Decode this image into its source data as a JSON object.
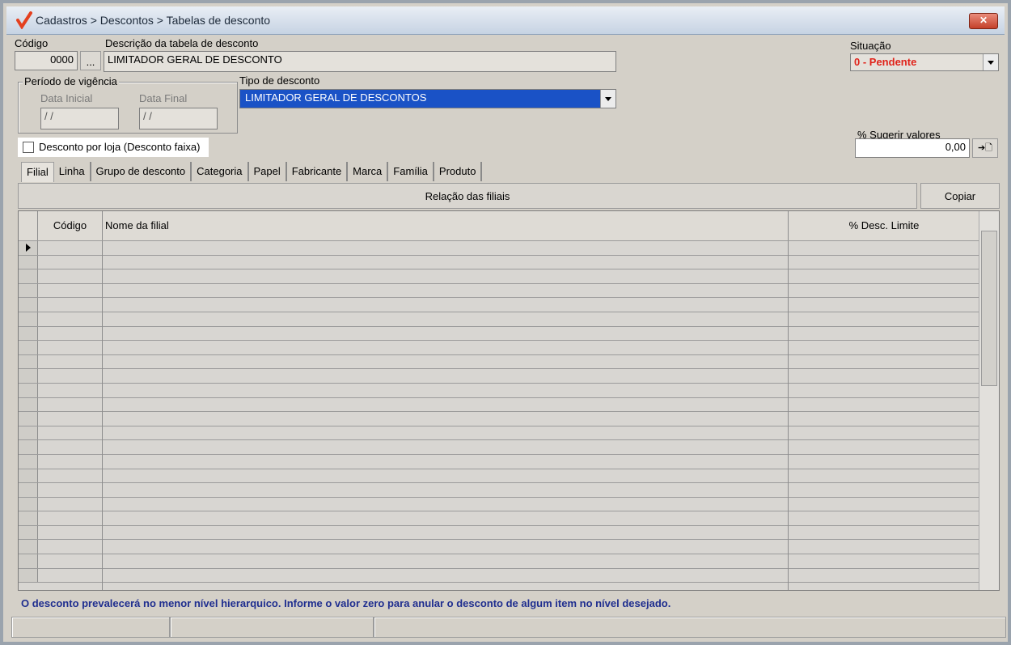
{
  "window": {
    "title": "Cadastros > Descontos > Tabelas de desconto",
    "close_symbol": "✕"
  },
  "form": {
    "codigo_label": "Código",
    "codigo_value": "0000",
    "lookup_button": "...",
    "descricao_label": "Descrição da tabela de desconto",
    "descricao_value": "LIMITADOR GERAL DE DESCONTO",
    "situacao_label": "Situação",
    "situacao_value": "0 - Pendente",
    "periodo_title": "Período de vigência",
    "data_inicial_label": "Data Inicial",
    "data_inicial_value": "/ /",
    "data_final_label": "Data Final",
    "data_final_value": "/ /",
    "tipo_label": "Tipo de desconto",
    "tipo_value": "LIMITADOR GERAL DE DESCONTOS",
    "sugerir_label": "% Sugerir valores",
    "sugerir_value": "0,00",
    "apply_icon_text": "➔🗋",
    "checkbox_label": "Desconto por loja (Desconto faixa)"
  },
  "tabs": [
    "Filial",
    "Linha",
    "Grupo de desconto",
    "Categoria",
    "Papel",
    "Fabricante",
    "Marca",
    "Família",
    "Produto"
  ],
  "relacao": {
    "title": "Relação das filiais",
    "copiar_label": "Copiar"
  },
  "grid": {
    "columns": [
      "Código",
      "Nome da filial",
      "% Desc. Limite"
    ],
    "row_count": 24
  },
  "info_message": "O desconto prevalecerá no menor nível hierarquico. Informe o valor zero para anular o desconto de algum item no nível desejado.",
  "colors": {
    "situacao_text": "#e0231a",
    "tipo_bg": "#1a52c6",
    "info_text": "#1f2e8f"
  }
}
